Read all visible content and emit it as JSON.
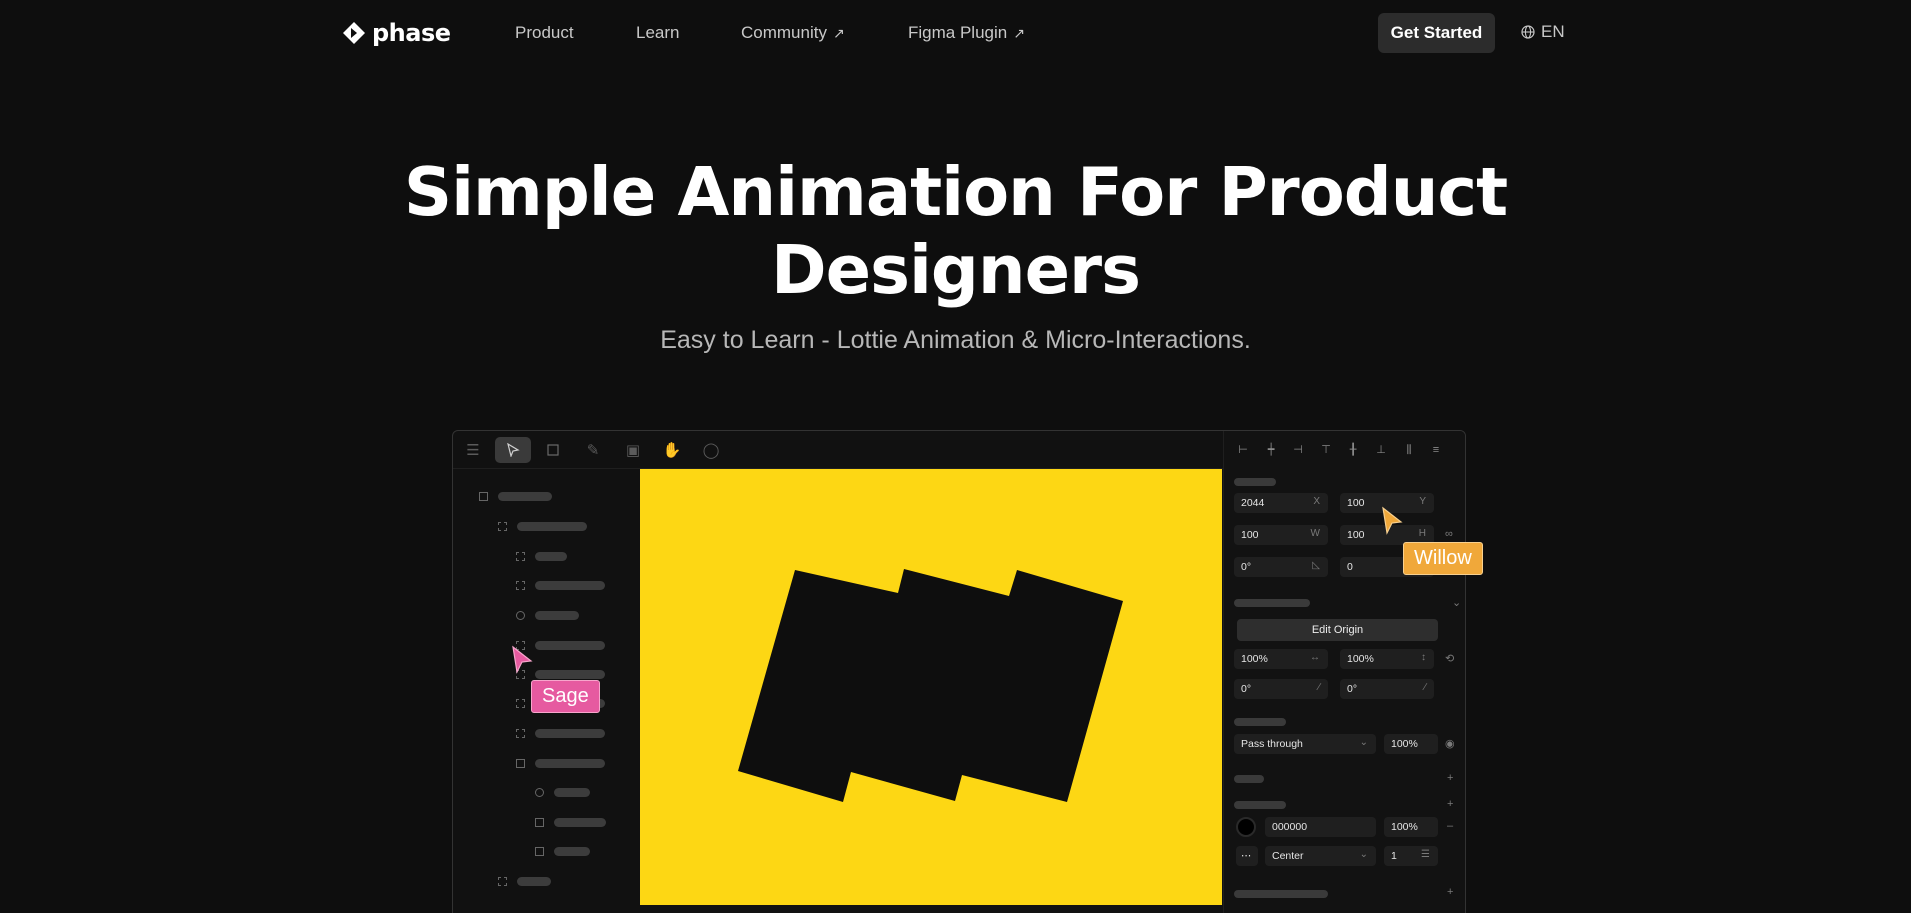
{
  "nav": {
    "logo_text": "phase",
    "links": [
      {
        "label": "Product",
        "external": false
      },
      {
        "label": "Learn",
        "external": false
      },
      {
        "label": "Community",
        "external": true
      },
      {
        "label": "Figma Plugin",
        "external": true
      }
    ],
    "cta_label": "Get Started",
    "language": "EN"
  },
  "hero": {
    "title_line1": "Simple Animation For Product",
    "title_line2": "Designers",
    "subtitle": "Easy to Learn - Lottie Animation & Micro-Interactions."
  },
  "editor": {
    "canvas_color": "#fdd714",
    "properties": {
      "x": "2044",
      "x_unit": "X",
      "y": "100",
      "y_unit": "Y",
      "w": "100",
      "w_unit": "W",
      "h": "100",
      "h_unit": "H",
      "rotation": "0°",
      "radius": "0",
      "edit_origin_label": "Edit Origin",
      "scale_x": "100%",
      "scale_y": "100%",
      "skew_x": "0°",
      "skew_y": "0°",
      "blend_mode": "Pass through",
      "opacity": "100%",
      "fill_hex": "000000",
      "fill_opacity": "100%",
      "stroke_align": "Center",
      "stroke_width": "1"
    },
    "cursors": [
      {
        "name": "Sage",
        "color": "#e65aa0"
      },
      {
        "name": "Willow",
        "color": "#f0a83a"
      }
    ]
  }
}
